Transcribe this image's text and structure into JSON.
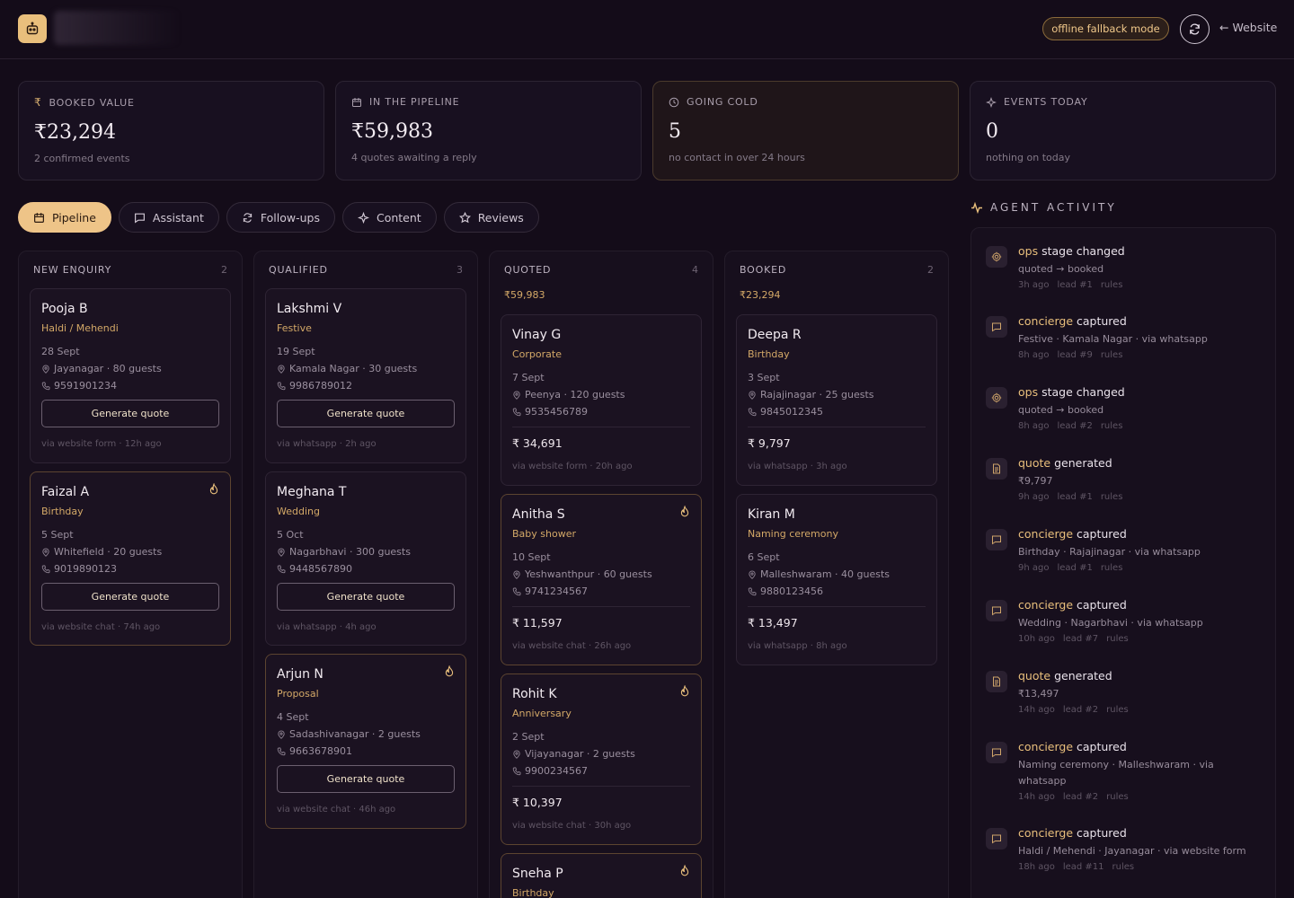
{
  "header": {
    "mode_badge": "offline fallback mode",
    "website_label": "Website"
  },
  "stats": [
    {
      "label": "BOOKED VALUE",
      "icon": "rupee-icon",
      "value": "₹23,294",
      "sub": "2 confirmed events"
    },
    {
      "label": "IN THE PIPELINE",
      "icon": "calendar-icon",
      "value": "₹59,983",
      "sub": "4 quotes awaiting a reply"
    },
    {
      "label": "GOING COLD",
      "icon": "clock-icon",
      "value": "5",
      "sub": "no contact in over 24 hours"
    },
    {
      "label": "EVENTS TODAY",
      "icon": "sparkle-icon",
      "value": "0",
      "sub": "nothing on today"
    }
  ],
  "tabs": [
    {
      "label": "Pipeline",
      "icon": "calendar-icon",
      "active": true
    },
    {
      "label": "Assistant",
      "icon": "chat-icon"
    },
    {
      "label": "Follow-ups",
      "icon": "refresh-icon"
    },
    {
      "label": "Content",
      "icon": "sparkle-icon"
    },
    {
      "label": "Reviews",
      "icon": "star-icon"
    }
  ],
  "columns": [
    {
      "title": "NEW ENQUIRY",
      "count": "2",
      "total": "",
      "cards": [
        {
          "name": "Pooja B",
          "type": "Haldi / Mehendi",
          "date": "28 Sept",
          "location": "Jayanagar · 80 guests",
          "phone": "9591901234",
          "button": "Generate quote",
          "via": "via website form · 12h ago",
          "hot": false
        },
        {
          "name": "Faizal A",
          "type": "Birthday",
          "date": "5 Sept",
          "location": "Whitefield · 20 guests",
          "phone": "9019890123",
          "button": "Generate quote",
          "via": "via website chat · 74h ago",
          "hot": true
        }
      ]
    },
    {
      "title": "QUALIFIED",
      "count": "3",
      "total": "",
      "cards": [
        {
          "name": "Lakshmi V",
          "type": "Festive",
          "date": "19 Sept",
          "location": "Kamala Nagar · 30 guests",
          "phone": "9986789012",
          "button": "Generate quote",
          "via": "via whatsapp · 2h ago",
          "hot": false
        },
        {
          "name": "Meghana T",
          "type": "Wedding",
          "date": "5 Oct",
          "location": "Nagarbhavi · 300 guests",
          "phone": "9448567890",
          "button": "Generate quote",
          "via": "via whatsapp · 4h ago",
          "hot": false
        },
        {
          "name": "Arjun N",
          "type": "Proposal",
          "date": "4 Sept",
          "location": "Sadashivanagar · 2 guests",
          "phone": "9663678901",
          "button": "Generate quote",
          "via": "via website chat · 46h ago",
          "hot": true
        }
      ]
    },
    {
      "title": "QUOTED",
      "count": "4",
      "total": "₹59,983",
      "cards": [
        {
          "name": "Vinay G",
          "type": "Corporate",
          "date": "7 Sept",
          "location": "Peenya · 120 guests",
          "phone": "9535456789",
          "price": "₹ 34,691",
          "via": "via website form · 20h ago",
          "hot": false
        },
        {
          "name": "Anitha S",
          "type": "Baby shower",
          "date": "10 Sept",
          "location": "Yeshwanthpur · 60 guests",
          "phone": "9741234567",
          "price": "₹ 11,597",
          "via": "via website chat · 26h ago",
          "hot": true
        },
        {
          "name": "Rohit K",
          "type": "Anniversary",
          "date": "2 Sept",
          "location": "Vijayanagar · 2 guests",
          "phone": "9900234567",
          "price": "₹ 10,397",
          "via": "via website chat · 30h ago",
          "hot": true
        },
        {
          "name": "Sneha P",
          "type": "Birthday",
          "hot": true
        }
      ]
    },
    {
      "title": "BOOKED",
      "count": "2",
      "total": "₹23,294",
      "cards": [
        {
          "name": "Deepa R",
          "type": "Birthday",
          "date": "3 Sept",
          "location": "Rajajinagar · 25 guests",
          "phone": "9845012345",
          "price": "₹ 9,797",
          "via": "via whatsapp · 3h ago",
          "hot": false
        },
        {
          "name": "Kiran M",
          "type": "Naming ceremony",
          "date": "6 Sept",
          "location": "Malleshwaram · 40 guests",
          "phone": "9880123456",
          "price": "₹ 13,497",
          "via": "via whatsapp · 8h ago",
          "hot": false
        }
      ]
    }
  ],
  "activity": {
    "title": "AGENT ACTIVITY",
    "items": [
      {
        "icon": "gear-icon",
        "agent": "ops",
        "action": "stage changed",
        "detail": "quoted → booked",
        "time": "3h ago",
        "lead": "lead #1",
        "src": "rules"
      },
      {
        "icon": "chat-icon",
        "agent": "concierge",
        "action": "captured",
        "detail": "Festive · Kamala Nagar · via whatsapp",
        "time": "8h ago",
        "lead": "lead #9",
        "src": "rules"
      },
      {
        "icon": "gear-icon",
        "agent": "ops",
        "action": "stage changed",
        "detail": "quoted → booked",
        "time": "8h ago",
        "lead": "lead #2",
        "src": "rules"
      },
      {
        "icon": "document-icon",
        "agent": "quote",
        "action": "generated",
        "detail": "₹9,797",
        "time": "9h ago",
        "lead": "lead #1",
        "src": "rules"
      },
      {
        "icon": "chat-icon",
        "agent": "concierge",
        "action": "captured",
        "detail": "Birthday · Rajajinagar · via whatsapp",
        "time": "9h ago",
        "lead": "lead #1",
        "src": "rules"
      },
      {
        "icon": "chat-icon",
        "agent": "concierge",
        "action": "captured",
        "detail": "Wedding · Nagarbhavi · via whatsapp",
        "time": "10h ago",
        "lead": "lead #7",
        "src": "rules"
      },
      {
        "icon": "document-icon",
        "agent": "quote",
        "action": "generated",
        "detail": "₹13,497",
        "time": "14h ago",
        "lead": "lead #2",
        "src": "rules"
      },
      {
        "icon": "chat-icon",
        "agent": "concierge",
        "action": "captured",
        "detail": "Naming ceremony · Malleshwaram · via whatsapp",
        "time": "14h ago",
        "lead": "lead #2",
        "src": "rules"
      },
      {
        "icon": "chat-icon",
        "agent": "concierge",
        "action": "captured",
        "detail": "Haldi / Mehendi · Jayanagar · via website form",
        "time": "18h ago",
        "lead": "lead #11",
        "src": "rules"
      }
    ]
  }
}
